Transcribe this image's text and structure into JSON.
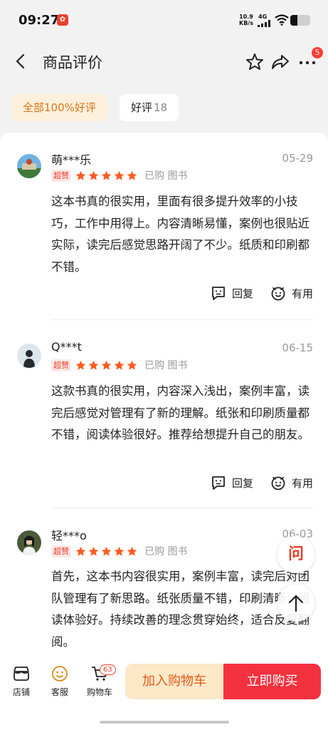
{
  "status_bar": {
    "time": "09:27",
    "net_speed_value": "10.9",
    "net_speed_unit": "KB/s",
    "network_type": "4G",
    "battery_level": 0.35
  },
  "nav": {
    "title": "商品评价",
    "more_badge": "5"
  },
  "filters": {
    "all_label": "全部100%好评",
    "good_label": "好评",
    "good_count": "18"
  },
  "reviews": [
    {
      "username": "萌***乐",
      "date": "05-29",
      "badge": "超赞",
      "rating": 5,
      "purchase": "已购 图书",
      "text": "这本书真的很实用，里面有很多提升效率的小技巧，工作中用得上。内容清晰易懂，案例也很贴近实际，读完后感觉思路开阔了不少。纸质和印刷都不错。",
      "reply_label": "回复",
      "useful_label": "有用"
    },
    {
      "username": "Q***t",
      "date": "06-15",
      "badge": "超赞",
      "rating": 5,
      "purchase": "已购 图书",
      "text": "这款书真的很实用，内容深入浅出，案例丰富，读完后感觉对管理有了新的理解。纸张和印刷质量都不错，阅读体验很好。推荐给想提升自己的朋友。",
      "reply_label": "回复",
      "useful_label": "有用"
    },
    {
      "username": "轻***o",
      "date": "06-03",
      "badge": "超赞",
      "rating": 5,
      "purchase": "已购 图书",
      "text": "首先，这本书内容很实用，案例丰富，读完后对团队管理有了新思路。纸张质量不错，印刷清晰，阅读体验好。持续改善的理念贯穿始终，适合反复翻阅。"
    }
  ],
  "floating": {
    "ask_label": "问"
  },
  "bottom_bar": {
    "store_label": "店铺",
    "service_label": "客服",
    "cart_label": "购物车",
    "cart_count": "63",
    "add_cart_label": "加入购物车",
    "buy_now_label": "立即购买"
  },
  "colors": {
    "accent_red": "#f4313f",
    "star": "#ff5a1f",
    "tab_active_bg": "#fdf0dc",
    "tab_active_text": "#d9741a"
  }
}
